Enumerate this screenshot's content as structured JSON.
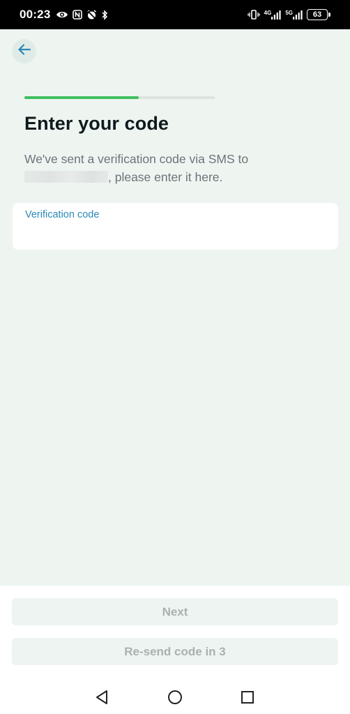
{
  "status_bar": {
    "time": "00:23",
    "network_1": "4G",
    "network_2": "5G",
    "battery": "63"
  },
  "header": {
    "back_icon": "arrow-left-icon",
    "progress_fraction": 0.6
  },
  "main": {
    "title": "Enter your code",
    "subtitle_line1": "We've sent a verification code via SMS to",
    "subtitle_line2_suffix": ", please enter it here.",
    "input": {
      "label": "Verification code",
      "value": "",
      "placeholder": ""
    }
  },
  "footer": {
    "next_label": "Next",
    "resend_label": "Re-send code in 3"
  },
  "nav": {
    "back": "nav-back-icon",
    "home": "nav-home-icon",
    "recents": "nav-recents-icon"
  },
  "colors": {
    "background": "#eef5f1",
    "accent_link": "#2a8ab5",
    "progress": "#3fbf5f",
    "button_disabled_bg": "#eef4f1",
    "button_disabled_text": "#a9b1ae"
  }
}
